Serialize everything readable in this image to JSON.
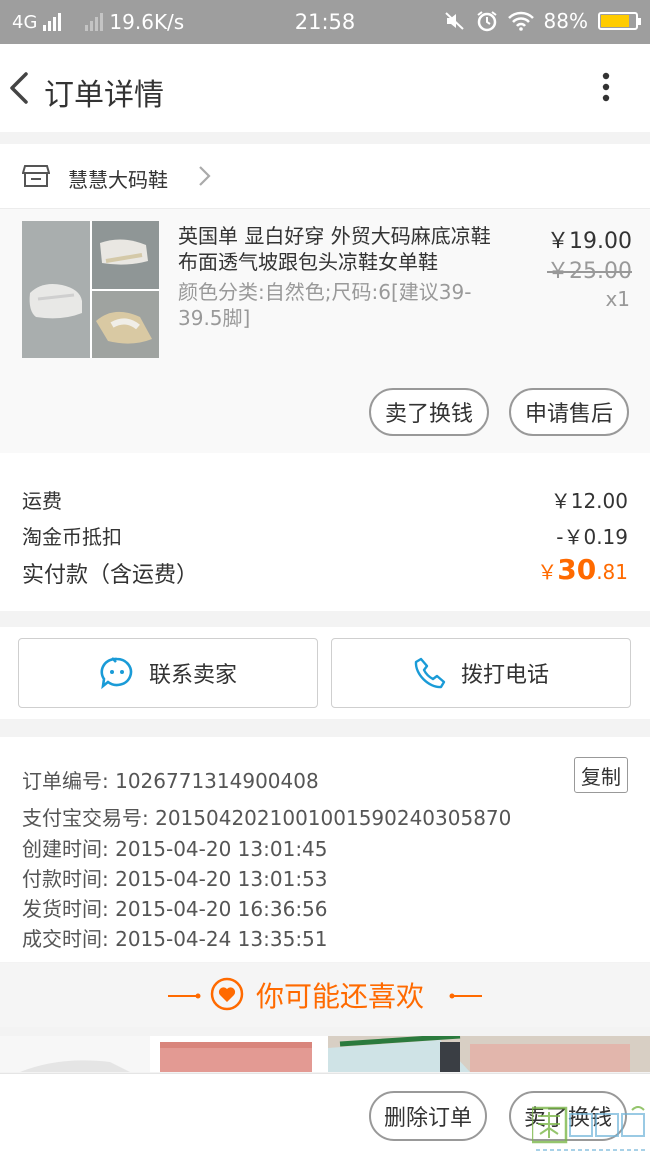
{
  "status_bar": {
    "network": "4G",
    "speed": "19.6K/s",
    "time": "21:58",
    "battery": "88%",
    "battery_level": 0.88
  },
  "navbar": {
    "title": "订单详情",
    "back_icon": "chevron-left-icon",
    "more_icon": "more-vertical-icon"
  },
  "shop": {
    "name": "慧慧大码鞋",
    "icon": "store-icon"
  },
  "product": {
    "title": "英国单 显白好穿 外贸大码麻底凉鞋 布面透气坡跟包头凉鞋女单鞋",
    "spec": "颜色分类:自然色;尺码:6[建议39-39.5脚]",
    "price": "￥19.00",
    "original_price": "￥25.00",
    "quantity": "x1",
    "buttons": {
      "sell": "卖了换钱",
      "after_sale": "申请售后"
    }
  },
  "fees": {
    "shipping_label": "运费",
    "shipping_value": "￥12.00",
    "coin_label": "淘金币抵扣",
    "coin_value": "-￥0.19",
    "total_label": "实付款（含运费）",
    "total_currency": "￥",
    "total_int": "30",
    "total_dec": ".81",
    "accent_color": "#ff6a00"
  },
  "actions": {
    "contact_seller": "联系卖家",
    "call_phone": "拨打电话",
    "icon_color": "#1a9bd7"
  },
  "order_info": {
    "order_no": "订单编号: 1026771314900408",
    "copy": "复制",
    "alipay_no": "支付宝交易号: 2015042021001001590240305870",
    "created": "创建时间: 2015-04-20 13:01:45",
    "paid": "付款时间: 2015-04-20 13:01:53",
    "shipped": "发货时间: 2015-04-20 16:36:56",
    "completed": "成交时间: 2015-04-24 13:35:51"
  },
  "recommend": {
    "title": "你可能还喜欢"
  },
  "bottom_bar": {
    "delete_order": "删除订单",
    "sell": "卖了换钱"
  }
}
